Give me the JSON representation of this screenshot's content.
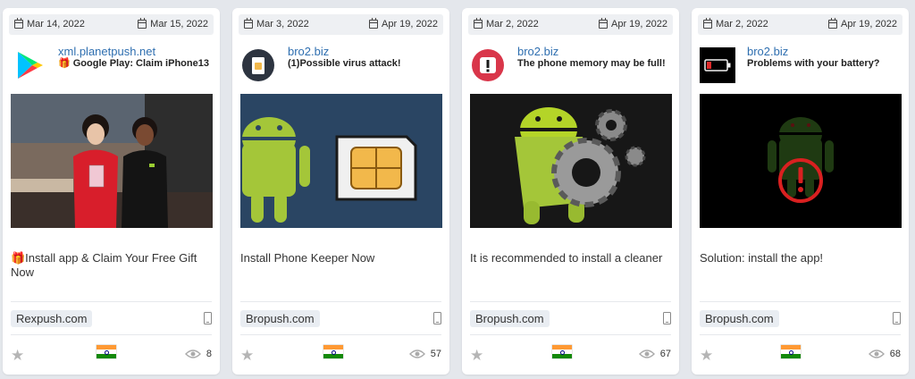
{
  "cards": [
    {
      "first_seen": "Mar 14, 2022",
      "last_seen": "Mar 15, 2022",
      "domain": "xml.planetpush.net",
      "headline": "🎁 Google Play: Claim iPhone13",
      "body": "🎁Install app & Claim Your Free Gift Now",
      "network": "Rexpush.com",
      "views": "8",
      "icon": "google-play-icon",
      "country": "India"
    },
    {
      "first_seen": "Mar 3, 2022",
      "last_seen": "Apr 19, 2022",
      "domain": "bro2.biz",
      "headline": "(1)Possible virus attack!",
      "body": "Install Phone Keeper Now",
      "network": "Bropush.com",
      "views": "57",
      "icon": "sim-card-icon",
      "country": "India"
    },
    {
      "first_seen": "Mar 2, 2022",
      "last_seen": "Apr 19, 2022",
      "domain": "bro2.biz",
      "headline": "The phone memory may be full!",
      "body": "It is recommended to install a cleaner",
      "network": "Bropush.com",
      "views": "67",
      "icon": "warning-icon",
      "country": "India"
    },
    {
      "first_seen": "Mar 2, 2022",
      "last_seen": "Apr 19, 2022",
      "domain": "bro2.biz",
      "headline": "Problems with your battery?",
      "body": "Solution: install the app!",
      "network": "Bropush.com",
      "views": "68",
      "icon": "low-battery-icon",
      "country": "India"
    }
  ]
}
